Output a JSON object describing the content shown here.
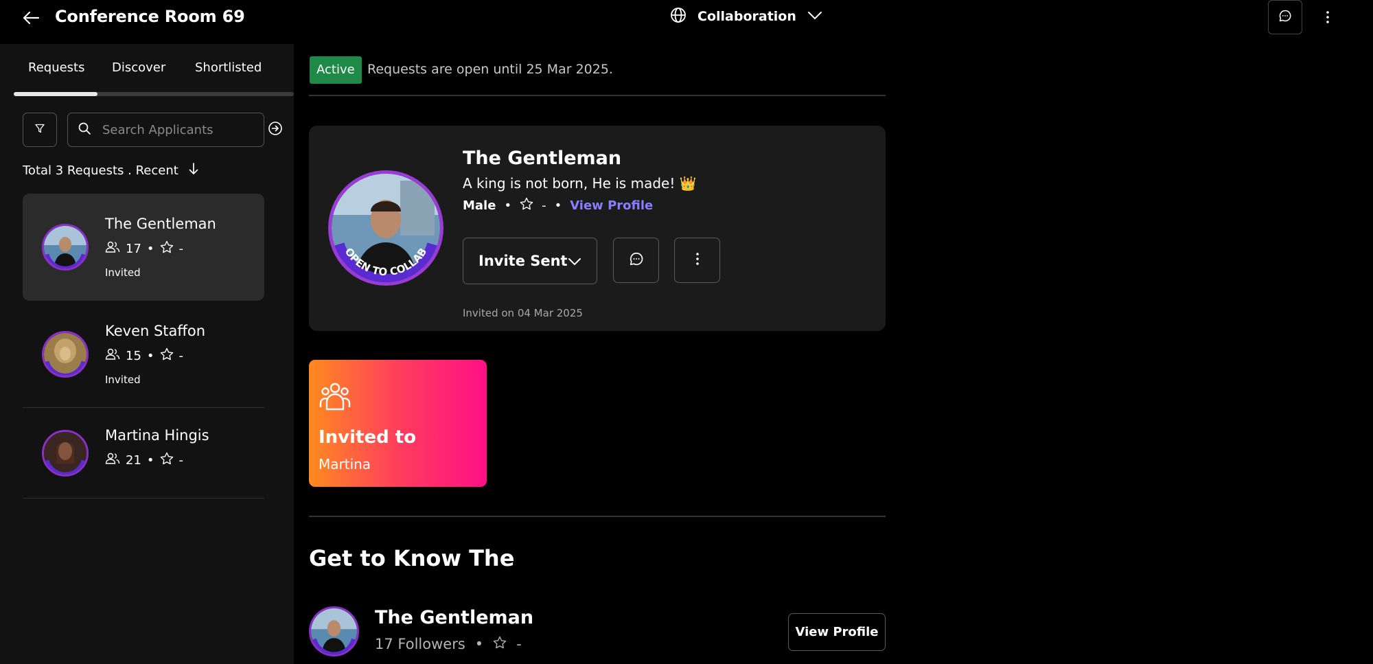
{
  "header": {
    "title": "Conference Room 69",
    "category_label": "Collaboration"
  },
  "tabs": [
    {
      "label": "Requests",
      "active": true
    },
    {
      "label": "Discover",
      "active": false
    },
    {
      "label": "Shortlisted",
      "active": false
    }
  ],
  "search": {
    "placeholder": "Search Applicants"
  },
  "total": {
    "text": "Total 3 Requests . Recent"
  },
  "requests": [
    {
      "name": "The Gentleman",
      "followers": "17",
      "rating": "-",
      "status": "Invited",
      "selected": true
    },
    {
      "name": "Keven Staffon",
      "followers": "15",
      "rating": "-",
      "status": "Invited",
      "selected": false
    },
    {
      "name": "Martina Hingis",
      "followers": "21",
      "rating": "-",
      "status": "",
      "selected": false
    }
  ],
  "status": {
    "badge": "Active",
    "text": "Requests are open until 25 Mar 2025.",
    "badge_color": "#1f8a48"
  },
  "profile": {
    "name": "The Gentleman",
    "bio": "A king is not born, He is made! 👑",
    "gender": "Male",
    "rating": "-",
    "view_profile": "View Profile",
    "invite_label": "Invite Sent",
    "invited_on": "Invited on 04 Mar 2025",
    "avatar_badge": "OPEN TO COLLAB"
  },
  "promo": {
    "title": "Invited to",
    "subtitle": "Martina"
  },
  "get_to_know": {
    "heading": "Get to Know The",
    "name": "The Gentleman",
    "followers": "17 Followers",
    "rating": "-",
    "view_profile": "View Profile"
  },
  "colors": {
    "accent_link": "#8a7dff",
    "avatar_ring": "#9b3bd6"
  }
}
